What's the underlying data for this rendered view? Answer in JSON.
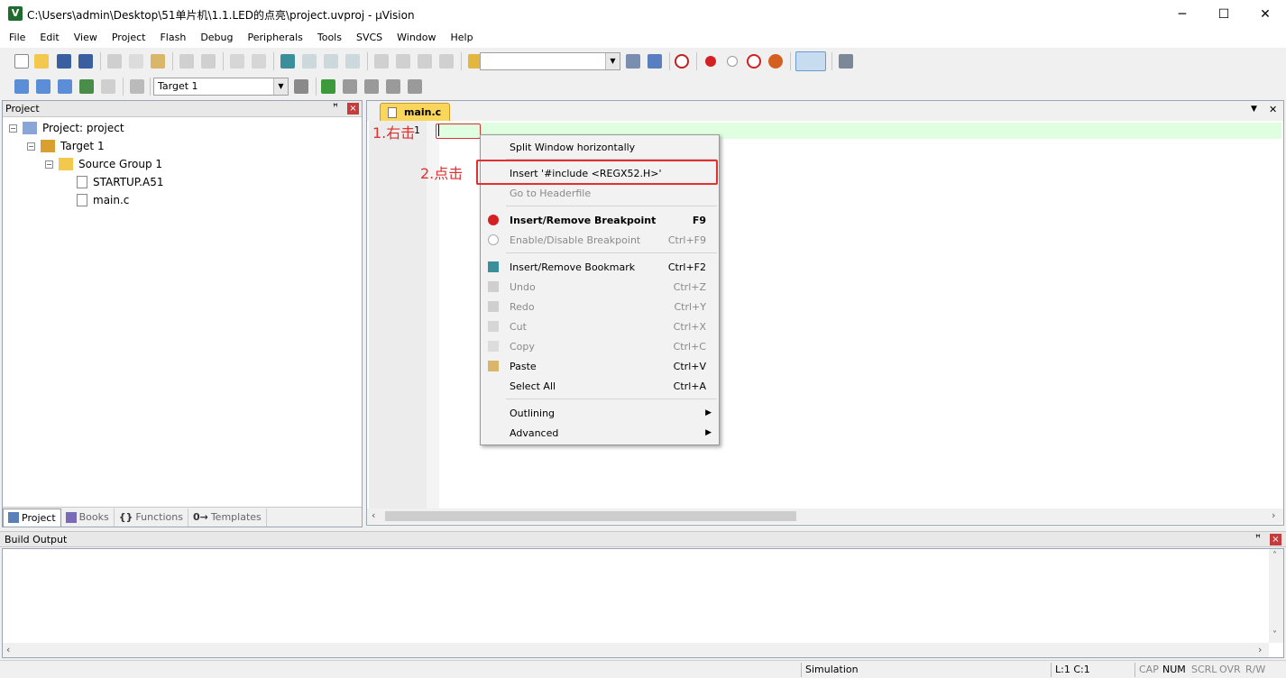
{
  "window": {
    "title": "C:\\Users\\admin\\Desktop\\51单片机\\1.1.LED的点亮\\project.uvproj - µVision",
    "app_icon": "uvision-icon",
    "minimize": "─",
    "maximize": "☐",
    "close": "✕"
  },
  "menu": [
    "File",
    "Edit",
    "View",
    "Project",
    "Flash",
    "Debug",
    "Peripherals",
    "Tools",
    "SVCS",
    "Window",
    "Help"
  ],
  "toolbar2": {
    "target_combo": "Target 1"
  },
  "project_panel": {
    "title": "Project",
    "pin": "ꟸ",
    "close": "×",
    "tree": {
      "root": "Project: project",
      "target": "Target 1",
      "group": "Source Group 1",
      "files": [
        "STARTUP.A51",
        "main.c"
      ]
    },
    "tabs": [
      "Project",
      "Books",
      "Functions",
      "Templates"
    ],
    "tab_glyphs": {
      "functions": "{}",
      "templates": "0→"
    }
  },
  "editor": {
    "tab": "main.c",
    "line_number": "1",
    "annotation_1": "1.右击",
    "annotation_2": "2.点击",
    "dropdown_glyph": "▼",
    "close_glyph": "✕",
    "scroll_left": "‹",
    "scroll_right": "›"
  },
  "context_menu": {
    "items": [
      {
        "label": "Split Window horizontally",
        "shortcut": ""
      },
      {
        "label": "Insert '#include <REGX52.H>'",
        "shortcut": ""
      },
      {
        "label": "Go to Headerfile",
        "shortcut": ""
      },
      {
        "label": "Insert/Remove Breakpoint",
        "shortcut": "F9"
      },
      {
        "label": "Enable/Disable Breakpoint",
        "shortcut": "Ctrl+F9"
      },
      {
        "label": "Insert/Remove Bookmark",
        "shortcut": "Ctrl+F2"
      },
      {
        "label": "Undo",
        "shortcut": "Ctrl+Z"
      },
      {
        "label": "Redo",
        "shortcut": "Ctrl+Y"
      },
      {
        "label": "Cut",
        "shortcut": "Ctrl+X"
      },
      {
        "label": "Copy",
        "shortcut": "Ctrl+C"
      },
      {
        "label": "Paste",
        "shortcut": "Ctrl+V"
      },
      {
        "label": "Select All",
        "shortcut": "Ctrl+A"
      },
      {
        "label": "Outlining",
        "shortcut": ""
      },
      {
        "label": "Advanced",
        "shortcut": ""
      }
    ],
    "submenu_arrow": "▶"
  },
  "build_output": {
    "title": "Build Output",
    "pin": "ꟸ",
    "close": "×",
    "scroll_up": "˄",
    "scroll_down": "˅",
    "scroll_left": "‹",
    "scroll_right": "›"
  },
  "statusbar": {
    "mode": "Simulation",
    "position": "L:1 C:1",
    "cap": "CAP",
    "num": "NUM",
    "scrl": "SCRL",
    "ovr": "OVR",
    "rw": "R/W"
  },
  "colors": {
    "annotation": "#e03030",
    "tab_active": "#fad65a",
    "line_highlight": "#e0ffe0",
    "breakpoint": "#d42020"
  }
}
